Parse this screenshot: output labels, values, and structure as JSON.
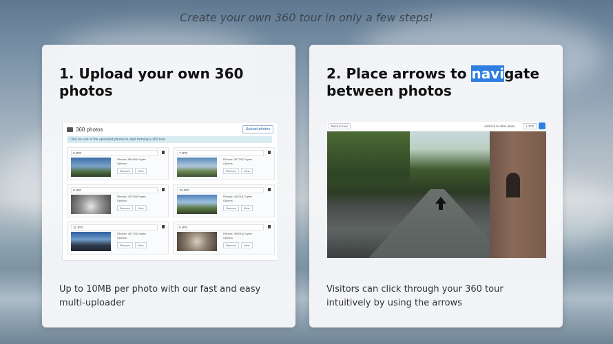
{
  "tagline": "Create your own 360 tour in only a few steps!",
  "cards": [
    {
      "title": "1. Upload your own 360 photos",
      "description": "Up to 10MB per photo with our fast and easy multi-uploader",
      "uploader": {
        "heading": "360 photos",
        "upload_button": "Upload photos",
        "info": "Click on one of the uploaded photos to start forming a 360 tour",
        "tiles": [
          {
            "name": "6.JPG",
            "size": "Filesize: 5944904 bytes",
            "options": "Options:",
            "remove": "Remove",
            "view": "View"
          },
          {
            "name": "7.JPG",
            "size": "Filesize: 3677957 bytes",
            "options": "Options:",
            "remove": "Remove",
            "view": "View"
          },
          {
            "name": "8.JPG",
            "size": "Filesize: 4037560 bytes",
            "options": "Options:",
            "remove": "Remove",
            "view": "View"
          },
          {
            "name": "10.JPG",
            "size": "Filesize: 4030187 bytes",
            "options": "Options:",
            "remove": "Remove",
            "view": "View"
          },
          {
            "name": "11.JPG",
            "size": "Filesize: 4017343 bytes",
            "options": "Options:",
            "remove": "Remove",
            "view": "View"
          },
          {
            "name": "9.JPG",
            "size": "Filesize: 3990162 bytes",
            "options": "Options:",
            "remove": "Remove",
            "view": "View"
          }
        ]
      }
    },
    {
      "title_before": "2. Place arrows to ",
      "title_highlight": "navi",
      "title_after": "gate between photos",
      "description": "Visitors can click through your 360 tour intuitively by using the arrows",
      "viewer": {
        "back_label": "Back to tour",
        "link_label": "Add link to other photo",
        "selected_photo": "1.JPG"
      }
    }
  ]
}
